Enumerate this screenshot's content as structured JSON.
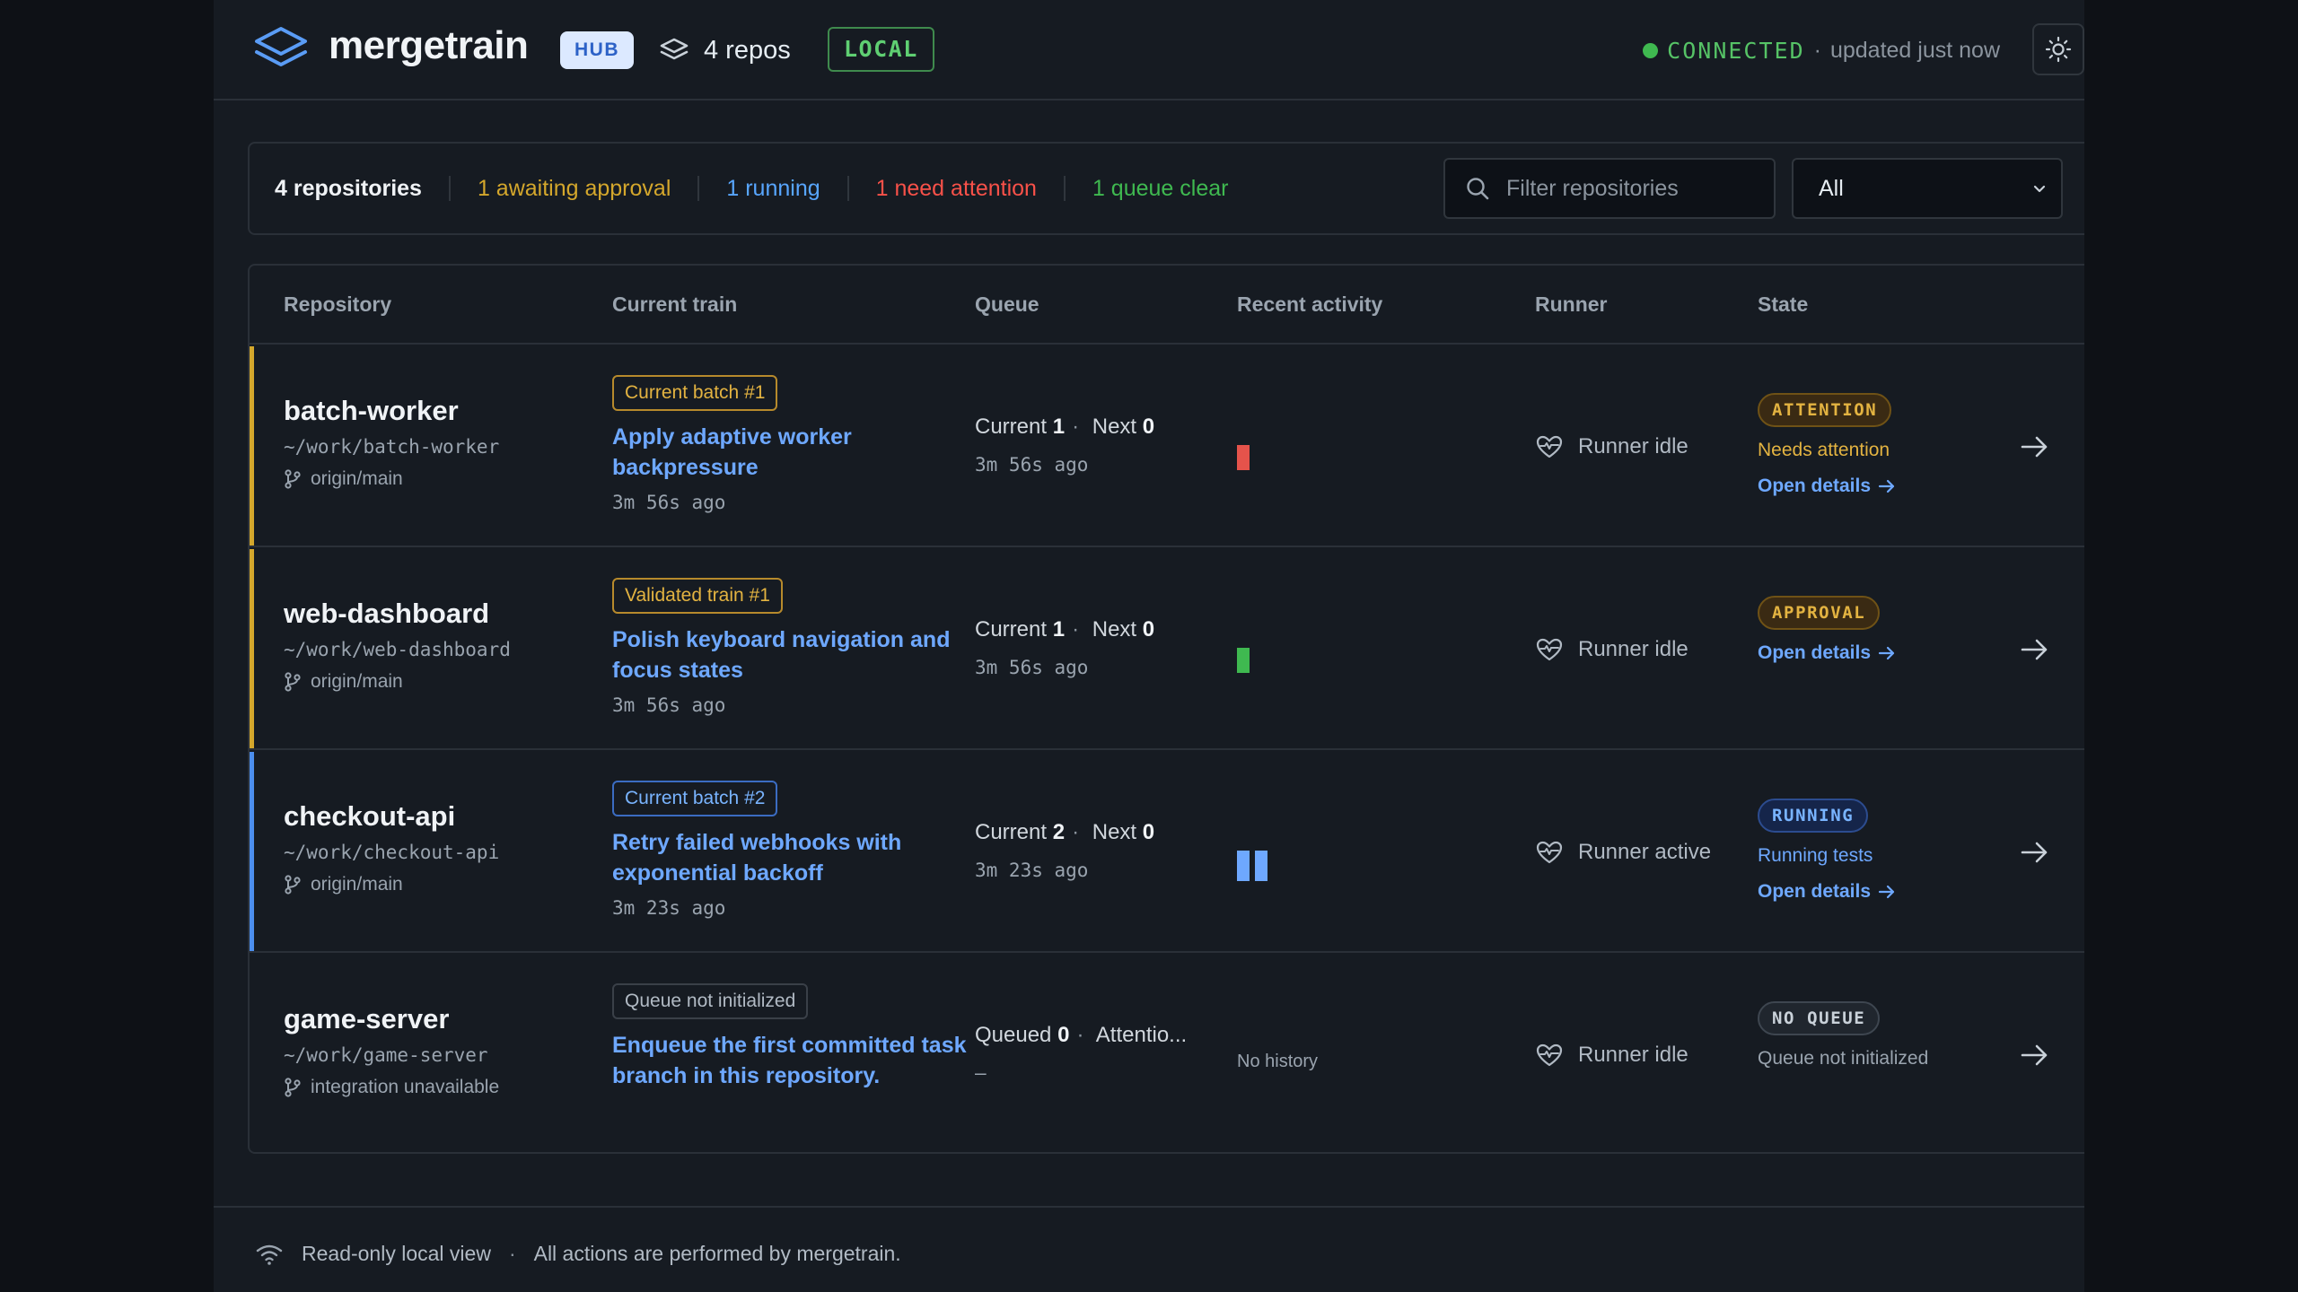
{
  "header": {
    "brand": "mergetrain",
    "hub_badge": "HUB",
    "repos_label": "4 repos",
    "local_badge": "LOCAL",
    "connection_status": "CONNECTED",
    "separator": "·",
    "updated_text": "updated just now",
    "icons": {
      "logo": "layers-logo-icon",
      "repos": "layers-icon",
      "theme": "sun-icon"
    },
    "colors": {
      "connected": "#3fb950",
      "hub_bg": "#dce9ff",
      "local": "#5fcf72"
    }
  },
  "summary": {
    "total": "4 repositories",
    "awaiting": "1 awaiting approval",
    "running": "1 running",
    "attention": "1 need attention",
    "clear": "1 queue clear",
    "filter_placeholder": "Filter repositories",
    "filter_select_value": "All"
  },
  "table": {
    "columns": [
      "Repository",
      "Current train",
      "Queue",
      "Recent activity",
      "Runner",
      "State"
    ],
    "rows": [
      {
        "name": "batch-worker",
        "path": "~/work/batch-worker",
        "branch": "origin/main",
        "accent": "#d4a72c",
        "train_badge": "Current batch #1",
        "train_title": "Apply adaptive worker backpressure",
        "train_time": "3m 56s ago",
        "queue_label_a": "Current",
        "queue_value_a": "1",
        "queue_label_b": "Next",
        "queue_value_b": "0",
        "queue_time": "3m 56s ago",
        "activity": [
          {
            "color": "#e5534b",
            "level": 0.5
          }
        ],
        "runner": "Runner idle",
        "state_badge": "ATTENTION",
        "state_desc": "Needs attention",
        "state_desc_color": "#e3b341",
        "open_details": "Open details"
      },
      {
        "name": "web-dashboard",
        "path": "~/work/web-dashboard",
        "branch": "origin/main",
        "accent": "#d4a72c",
        "train_badge": "Validated train #1",
        "train_title": "Polish keyboard navigation and focus states",
        "train_time": "3m 56s ago",
        "queue_label_a": "Current",
        "queue_value_a": "1",
        "queue_label_b": "Next",
        "queue_value_b": "0",
        "queue_time": "3m 56s ago",
        "activity": [
          {
            "color": "#3fb950",
            "level": 0.5
          }
        ],
        "runner": "Runner idle",
        "state_badge": "APPROVAL",
        "open_details": "Open details"
      },
      {
        "name": "checkout-api",
        "path": "~/work/checkout-api",
        "branch": "origin/main",
        "accent": "#4c8eed",
        "train_badge": "Current batch #2",
        "train_title": "Retry failed webhooks with exponential backoff",
        "train_time": "3m 23s ago",
        "queue_label_a": "Current",
        "queue_value_a": "2",
        "queue_label_b": "Next",
        "queue_value_b": "0",
        "queue_time": "3m 23s ago",
        "activity": [
          {
            "color": "#6ea8ff",
            "level": 0.6
          },
          {
            "color": "#6ea8ff",
            "level": 0.6
          }
        ],
        "runner": "Runner active",
        "state_badge": "RUNNING",
        "state_desc": "Running tests",
        "state_desc_color": "#6ea8ff",
        "open_details": "Open details"
      },
      {
        "name": "game-server",
        "path": "~/work/game-server",
        "branch": "integration unavailable",
        "accent": "",
        "train_badge": "Queue not initialized",
        "train_title": "Enqueue the first committed task branch in this repository.",
        "train_time": "",
        "queue_label_a": "Queued",
        "queue_value_a": "0",
        "queue_label_b": "Attentio...",
        "queue_value_b": "",
        "queue_time": "–",
        "no_history": "No history",
        "runner": "Runner idle",
        "state_badge": "NO QUEUE",
        "state_desc": "Queue not initialized",
        "state_desc_color": "#9aa4af"
      }
    ]
  },
  "footer": {
    "readonly": "Read-only local view",
    "separator": "·",
    "note": "All actions are performed by mergetrain."
  }
}
